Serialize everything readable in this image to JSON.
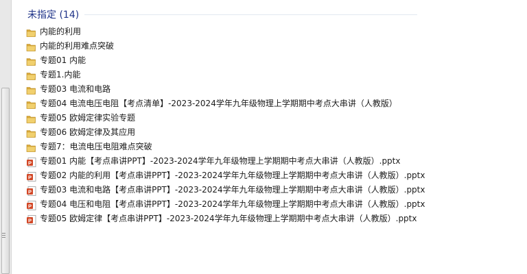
{
  "group": {
    "title": "未指定 (14)"
  },
  "items": [
    {
      "name": "内能的利用",
      "icon": "folder-icon"
    },
    {
      "name": "内能的利用难点突破",
      "icon": "folder-icon"
    },
    {
      "name": "专题01 内能",
      "icon": "folder-icon"
    },
    {
      "name": "专题1.内能",
      "icon": "folder-icon"
    },
    {
      "name": "专题03 电流和电路",
      "icon": "folder-icon"
    },
    {
      "name": "专题04 电流电压电阻【考点清单】-2023-2024学年九年级物理上学期期中考点大串讲（人教版）",
      "icon": "folder-icon"
    },
    {
      "name": "专题05 欧姆定律实验专题",
      "icon": "folder-icon"
    },
    {
      "name": "专题06 欧姆定律及其应用",
      "icon": "folder-icon"
    },
    {
      "name": "专题7：电流电压电阻难点突破",
      "icon": "folder-icon"
    },
    {
      "name": "专题01 内能【考点串讲PPT】-2023-2024学年九年级物理上学期期中考点大串讲（人教版）.pptx",
      "icon": "powerpoint-file-icon"
    },
    {
      "name": "专题02 内能的利用【考点串讲PPT】-2023-2024学年九年级物理上学期期中考点大串讲（人教版）.pptx",
      "icon": "powerpoint-file-icon"
    },
    {
      "name": "专题03 电流和电路【考点串讲PPT】-2023-2024学年九年级物理上学期期中考点大串讲（人教版）.pptx",
      "icon": "powerpoint-file-icon"
    },
    {
      "name": "专题04 电压和电阻【考点串讲PPT】-2023-2024学年九年级物理上学期期中考点大串讲（人教版）.pptx",
      "icon": "powerpoint-file-icon"
    },
    {
      "name": "专题05 欧姆定律【考点串讲PPT】-2023-2024学年九年级物理上学期期中考点大串讲（人教版）.pptx",
      "icon": "powerpoint-file-icon"
    }
  ],
  "colors": {
    "group_title": "#1e3287",
    "folder": "#e8c25e",
    "pptx": "#d24726"
  }
}
